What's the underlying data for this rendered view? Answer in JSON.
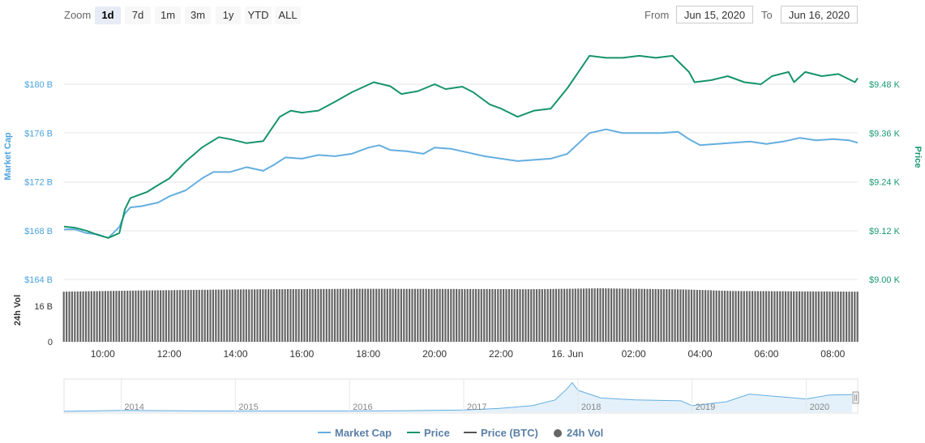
{
  "range_selector": {
    "zoom_label": "Zoom",
    "buttons": [
      {
        "label": "1d",
        "active": true
      },
      {
        "label": "7d",
        "active": false
      },
      {
        "label": "1m",
        "active": false
      },
      {
        "label": "3m",
        "active": false
      },
      {
        "label": "1y",
        "active": false
      },
      {
        "label": "YTD",
        "active": false
      },
      {
        "label": "ALL",
        "active": false
      }
    ],
    "from_label": "From",
    "from_value": "Jun 15, 2020",
    "to_label": "To",
    "to_value": "Jun 16, 2020"
  },
  "colors": {
    "market_cap": "#64aee0",
    "price": "#16946a",
    "volume": "#666666",
    "price_btc": "#555555",
    "legend_text": "#5a7fa8",
    "axis_text_left": "#4aa3df",
    "axis_text_right": "#1a9873"
  },
  "legend": [
    {
      "label": "Market Cap",
      "kind": "line",
      "color": "#64aee0"
    },
    {
      "label": "Price",
      "kind": "line",
      "color": "#16946a"
    },
    {
      "label": "Price (BTC)",
      "kind": "line",
      "color": "#555555"
    },
    {
      "label": "24h Vol",
      "kind": "dot",
      "color": "#666666"
    }
  ],
  "chart_data": [
    {
      "type": "line",
      "title": "",
      "x_ticks": [
        "10:00",
        "12:00",
        "14:00",
        "16:00",
        "18:00",
        "20:00",
        "22:00",
        "16. Jun",
        "02:00",
        "04:00",
        "06:00",
        "08:00"
      ],
      "x_range": [
        "2020-06-15 08:50",
        "2020-06-16 08:45"
      ],
      "y_left": {
        "label": "Market Cap",
        "ticks": [
          "$164 B",
          "$168 B",
          "$172 B",
          "$176 B",
          "$180 B"
        ],
        "ylim": [
          164,
          180
        ]
      },
      "y_right": {
        "label": "Price",
        "ticks": [
          "$9.00 K",
          "$9.12 K",
          "$9.24 K",
          "$9.36 K",
          "$9.48 K"
        ],
        "ylim": [
          9.0,
          9.48
        ]
      },
      "grid": true,
      "series": [
        {
          "name": "Market Cap",
          "axis": "left",
          "unit": "B",
          "x": [
            "2020-06-15 08:50",
            "2020-06-15 09:10",
            "2020-06-15 09:30",
            "2020-06-15 09:50",
            "2020-06-15 10:10",
            "2020-06-15 10:30",
            "2020-06-15 10:40",
            "2020-06-15 10:50",
            "2020-06-15 11:10",
            "2020-06-15 11:40",
            "2020-06-15 12:00",
            "2020-06-15 12:30",
            "2020-06-15 13:00",
            "2020-06-15 13:20",
            "2020-06-15 13:50",
            "2020-06-15 14:20",
            "2020-06-15 14:50",
            "2020-06-15 15:10",
            "2020-06-15 15:30",
            "2020-06-15 16:00",
            "2020-06-15 16:30",
            "2020-06-15 17:00",
            "2020-06-15 17:30",
            "2020-06-15 18:00",
            "2020-06-15 18:20",
            "2020-06-15 18:40",
            "2020-06-15 19:10",
            "2020-06-15 19:40",
            "2020-06-15 20:00",
            "2020-06-15 20:30",
            "2020-06-15 21:00",
            "2020-06-15 21:30",
            "2020-06-15 22:00",
            "2020-06-15 22:30",
            "2020-06-15 23:00",
            "2020-06-15 23:30",
            "2020-06-16 00:00",
            "2020-06-16 00:40",
            "2020-06-16 01:10",
            "2020-06-16 01:40",
            "2020-06-16 02:10",
            "2020-06-16 02:50",
            "2020-06-16 03:20",
            "2020-06-16 03:40",
            "2020-06-16 04:00",
            "2020-06-16 04:30",
            "2020-06-16 05:00",
            "2020-06-16 05:30",
            "2020-06-16 06:00",
            "2020-06-16 06:30",
            "2020-06-16 07:00",
            "2020-06-16 07:30",
            "2020-06-16 08:00",
            "2020-06-16 08:30",
            "2020-06-16 08:45"
          ],
          "values": [
            168.1,
            168.1,
            167.8,
            167.7,
            167.4,
            168.3,
            169.4,
            169.9,
            170.0,
            170.3,
            170.8,
            171.3,
            172.3,
            172.8,
            172.8,
            173.2,
            172.9,
            173.4,
            174.0,
            173.9,
            174.2,
            174.1,
            174.3,
            174.8,
            175.0,
            174.6,
            174.5,
            174.3,
            174.8,
            174.7,
            174.4,
            174.1,
            173.9,
            173.7,
            173.8,
            173.9,
            174.3,
            176.0,
            176.3,
            176.0,
            176.0,
            176.0,
            176.1,
            175.5,
            175.0,
            175.1,
            175.2,
            175.3,
            175.1,
            175.3,
            175.6,
            175.4,
            175.5,
            175.4,
            175.2
          ]
        },
        {
          "name": "Price",
          "axis": "right",
          "unit": "K",
          "x": [
            "2020-06-15 08:50",
            "2020-06-15 09:10",
            "2020-06-15 09:30",
            "2020-06-15 09:50",
            "2020-06-15 10:10",
            "2020-06-15 10:30",
            "2020-06-15 10:40",
            "2020-06-15 10:50",
            "2020-06-15 11:00",
            "2020-06-15 11:20",
            "2020-06-15 11:40",
            "2020-06-15 12:00",
            "2020-06-15 12:30",
            "2020-06-15 13:00",
            "2020-06-15 13:30",
            "2020-06-15 13:50",
            "2020-06-15 14:20",
            "2020-06-15 14:50",
            "2020-06-15 15:20",
            "2020-06-15 15:40",
            "2020-06-15 16:00",
            "2020-06-15 16:30",
            "2020-06-15 17:00",
            "2020-06-15 17:30",
            "2020-06-15 18:10",
            "2020-06-15 18:40",
            "2020-06-15 19:00",
            "2020-06-15 19:30",
            "2020-06-15 20:00",
            "2020-06-15 20:20",
            "2020-06-15 20:50",
            "2020-06-15 21:10",
            "2020-06-15 21:40",
            "2020-06-15 22:00",
            "2020-06-15 22:30",
            "2020-06-15 23:00",
            "2020-06-15 23:30",
            "2020-06-16 00:00",
            "2020-06-16 00:20",
            "2020-06-16 00:40",
            "2020-06-16 01:10",
            "2020-06-16 01:40",
            "2020-06-16 02:10",
            "2020-06-16 02:40",
            "2020-06-16 03:10",
            "2020-06-16 03:40",
            "2020-06-16 03:50",
            "2020-06-16 04:20",
            "2020-06-16 04:50",
            "2020-06-16 05:20",
            "2020-06-16 05:50",
            "2020-06-16 06:10",
            "2020-06-16 06:40",
            "2020-06-16 06:50",
            "2020-06-16 07:10",
            "2020-06-16 07:40",
            "2020-06-16 08:10",
            "2020-06-16 08:40",
            "2020-06-16 08:45"
          ],
          "values": [
            9.13,
            9.127,
            9.12,
            9.11,
            9.102,
            9.114,
            9.172,
            9.2,
            9.205,
            9.215,
            9.232,
            9.248,
            9.29,
            9.325,
            9.35,
            9.345,
            9.335,
            9.34,
            9.4,
            9.415,
            9.41,
            9.415,
            9.437,
            9.46,
            9.485,
            9.475,
            9.456,
            9.463,
            9.48,
            9.468,
            9.474,
            9.46,
            9.43,
            9.42,
            9.4,
            9.415,
            9.42,
            9.47,
            9.51,
            9.55,
            9.545,
            9.545,
            9.55,
            9.545,
            9.55,
            9.51,
            9.485,
            9.49,
            9.5,
            9.485,
            9.48,
            9.5,
            9.51,
            9.485,
            9.51,
            9.5,
            9.505,
            9.485,
            9.495
          ]
        }
      ]
    },
    {
      "type": "bar",
      "title": "",
      "y_label": "24h Vol",
      "y_ticks": [
        "0",
        "16 B"
      ],
      "ylim": [
        0,
        28
      ],
      "series": [
        {
          "name": "24h Vol",
          "unit": "B",
          "x_range": [
            "2020-06-15 08:50",
            "2020-06-16 08:45"
          ],
          "level_points": [
            {
              "t": "2020-06-15 08:50",
              "v": 22.5
            },
            {
              "t": "2020-06-15 11:00",
              "v": 23.0
            },
            {
              "t": "2020-06-15 14:00",
              "v": 23.5
            },
            {
              "t": "2020-06-15 18:00",
              "v": 23.8
            },
            {
              "t": "2020-06-15 23:00",
              "v": 23.6
            },
            {
              "t": "2020-06-16 01:00",
              "v": 24.0
            },
            {
              "t": "2020-06-16 03:30",
              "v": 23.5
            },
            {
              "t": "2020-06-16 05:00",
              "v": 22.8
            },
            {
              "t": "2020-06-16 08:45",
              "v": 22.5
            }
          ]
        }
      ]
    },
    {
      "type": "area",
      "title": "",
      "role": "navigator",
      "x_ticks": [
        "2014",
        "2015",
        "2016",
        "2017",
        "2018",
        "2019",
        "2020"
      ],
      "series": [
        {
          "name": "Market Cap",
          "x": [
            2013.5,
            2014.0,
            2015.0,
            2016.0,
            2016.5,
            2017.0,
            2017.3,
            2017.6,
            2017.8,
            2017.9,
            2017.95,
            2018.0,
            2018.2,
            2018.5,
            2018.9,
            2019.0,
            2019.3,
            2019.5,
            2019.8,
            2020.0,
            2020.2,
            2020.4
          ],
          "values": [
            1,
            10,
            4,
            5,
            8,
            14,
            30,
            60,
            120,
            230,
            300,
            220,
            140,
            120,
            110,
            60,
            100,
            180,
            150,
            130,
            170,
            175
          ]
        }
      ]
    }
  ]
}
